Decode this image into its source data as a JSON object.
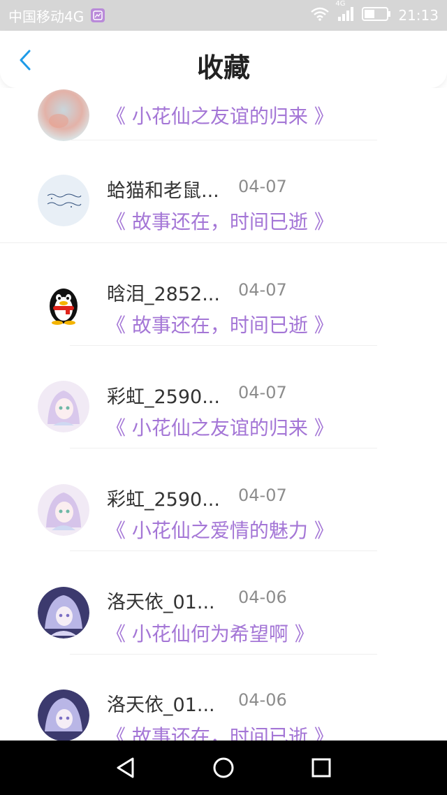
{
  "status_bar": {
    "carrier": "中国移动4G",
    "network_badge": "4G",
    "time": "21:13"
  },
  "header": {
    "title": "收藏",
    "back_icon": "chevron-left-icon"
  },
  "colors": {
    "accent": "#a476d6",
    "back": "#1e9be8",
    "status_bar_bg": "#d6d6d6",
    "nav_bar_bg": "#000000"
  },
  "items": [
    {
      "name": "",
      "date": "",
      "story": "《 小花仙之友谊的归来 》",
      "avatar": "blurred-avatar"
    },
    {
      "name": "蛤猫和老鼠...",
      "date": "04-07",
      "story": "《 故事还在，时间已逝 》",
      "avatar": "handwriting-avatar"
    },
    {
      "name": "晗泪_2852...",
      "date": "04-07",
      "story": "《 故事还在，时间已逝 》",
      "avatar": "qq-penguin-avatar"
    },
    {
      "name": "彩虹_2590...",
      "date": "04-07",
      "story": "《 小花仙之友谊的归来 》",
      "avatar": "anime-girl-avatar"
    },
    {
      "name": "彩虹_2590...",
      "date": "04-07",
      "story": "《 小花仙之爱情的魅力 》",
      "avatar": "anime-girl-avatar"
    },
    {
      "name": "洛天依_01...",
      "date": "04-06",
      "story": "《 小花仙何为希望啊 》",
      "avatar": "anime-girl-dark-avatar"
    },
    {
      "name": "洛天依_01...",
      "date": "04-06",
      "story": "《 故事还在，时间已逝 》",
      "avatar": "anime-girl-dark-avatar"
    }
  ],
  "nav_bar": {
    "back_icon": "triangle-back-icon",
    "home_icon": "circle-home-icon",
    "recents_icon": "square-recents-icon"
  }
}
